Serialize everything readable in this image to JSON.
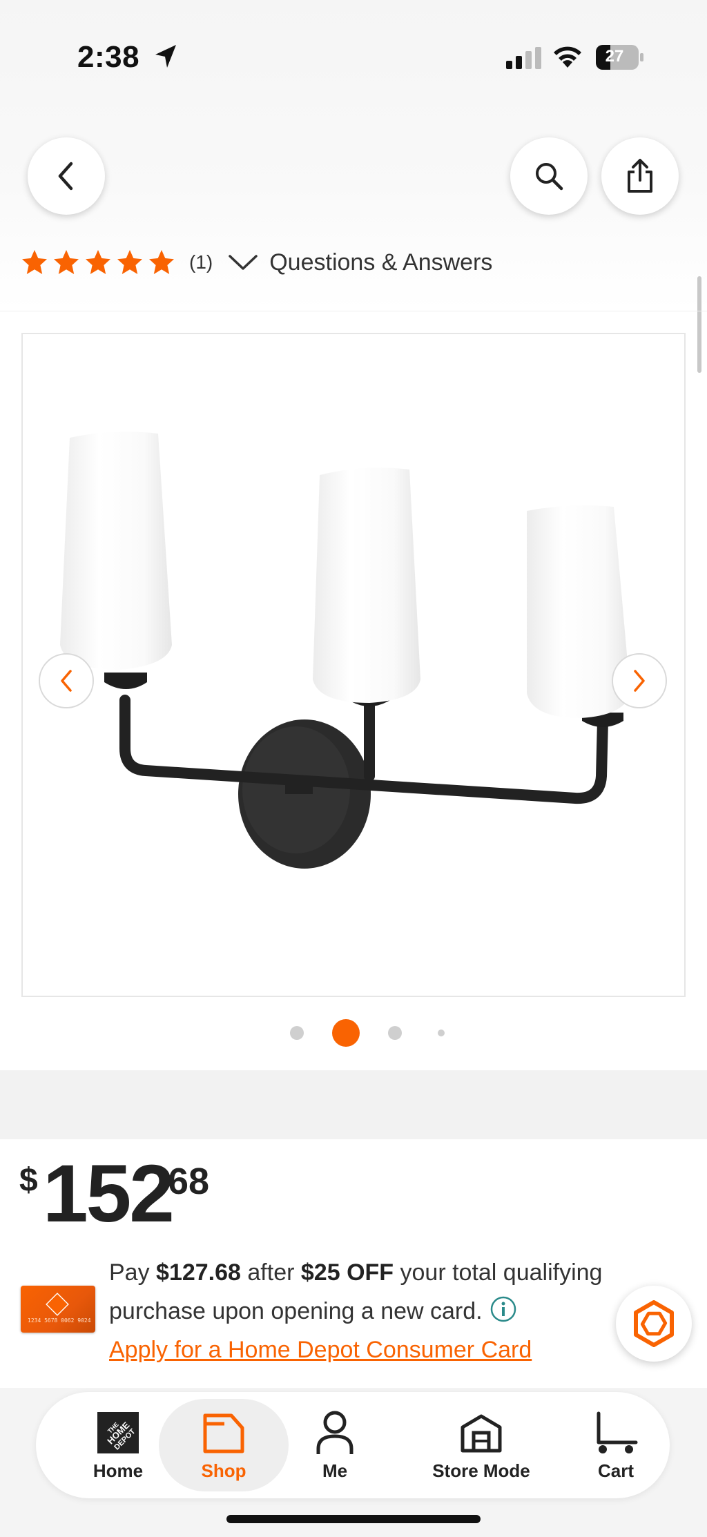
{
  "status_bar": {
    "time": "2:38",
    "battery": "27"
  },
  "header": {
    "back_icon": "chevron-left-icon",
    "search_icon": "search-icon",
    "share_icon": "share-icon"
  },
  "rating": {
    "stars": 5,
    "review_count": "(1)",
    "qa_label": "Questions & Answers"
  },
  "carousel": {
    "image_alt": "Three-light black vanity fixture with white glass shades",
    "total_images": 4,
    "active_index": 1
  },
  "price": {
    "dollar_sign": "$",
    "dollars": "152",
    "cents": "68"
  },
  "card_offer": {
    "pay_prefix": "Pay ",
    "pay_amount": "$127.68",
    "after_text": " after ",
    "discount": "$25 OFF",
    "rest_text": " your total qualifying purchase upon opening a new card.",
    "apply_link": "Apply for a Home Depot Consumer Card",
    "card_numbers": "1234 5678 0062 9024"
  },
  "bottom_nav": {
    "home": "Home",
    "shop": "Shop",
    "me": "Me",
    "store_mode": "Store Mode",
    "cart": "Cart",
    "active": "Shop"
  },
  "colors": {
    "brand_orange": "#f96302",
    "star_orange": "#f96302",
    "text_dark": "#222222",
    "dot_inactive": "#cfcfcf"
  }
}
